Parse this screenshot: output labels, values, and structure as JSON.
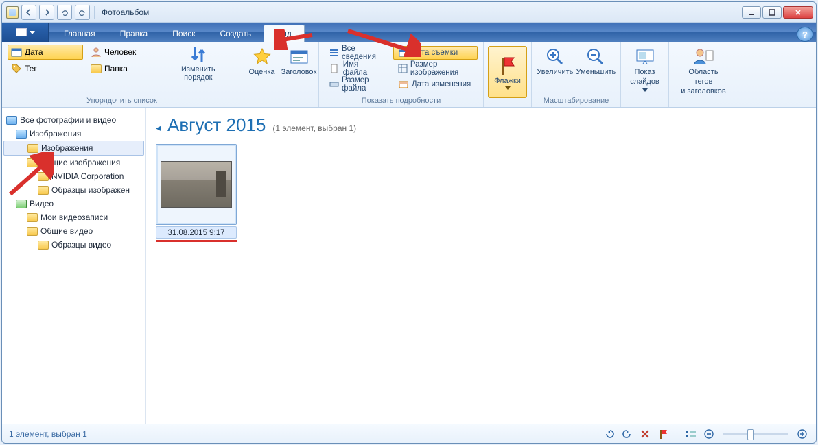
{
  "window": {
    "title": "Фотоальбом"
  },
  "tabs": {
    "main": "Главная",
    "edit": "Правка",
    "find": "Поиск",
    "create": "Создать",
    "view": "Вид"
  },
  "ribbon": {
    "arrange": {
      "label": "Упорядочить список",
      "date": "Дата",
      "tag": "Тег",
      "person": "Человек",
      "folder": "Папка",
      "change_order": "Изменить\nпорядок"
    },
    "rating_group": {
      "rating": "Оценка",
      "title": "Заголовок"
    },
    "details": {
      "label": "Показать подробности",
      "all": "Все сведения",
      "filename": "Имя файла",
      "filesize": "Размер файла",
      "date_taken": "Дата съемки",
      "image_size": "Размер изображения",
      "date_modified": "Дата изменения"
    },
    "flags": "Флажки",
    "zoom": {
      "label": "Масштабирование",
      "in": "Увеличить",
      "out": "Уменьшить"
    },
    "slideshow": "Показ\nслайдов",
    "tag_area": "Область тегов\nи заголовков"
  },
  "sidebar": {
    "all": "Все фотографии и видео",
    "images": "Изображения",
    "images_sub": "Изображения",
    "public_images": "Общие изображения",
    "nvidia": "NVIDIA Corporation",
    "sample_images": "Образцы изображен",
    "video": "Видео",
    "my_videos": "Мои видеозаписи",
    "public_video": "Общие видео",
    "sample_video": "Образцы видео"
  },
  "content": {
    "heading": "Август 2015",
    "sub": "(1 элемент, выбран 1)",
    "caption": "31.08.2015 9:17"
  },
  "status": {
    "text": "1 элемент, выбран 1"
  }
}
